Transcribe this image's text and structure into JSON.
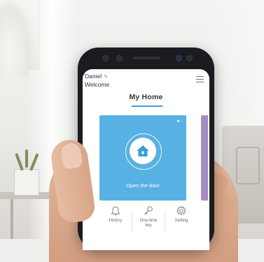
{
  "user": {
    "name": "Daniel",
    "greeting": "Welcome"
  },
  "page": {
    "title": "My Home"
  },
  "card": {
    "action_label": "Open the door",
    "color": "#57b1e2",
    "icon": "home-icon"
  },
  "nav": {
    "items": [
      {
        "label": "History",
        "icon": "bell-icon"
      },
      {
        "label": "One-time\nkey",
        "icon": "key-icon"
      },
      {
        "label": "Setting",
        "icon": "gear-icon"
      }
    ]
  },
  "colors": {
    "accent": "#3aa0d8",
    "side_card": "#a58ec4"
  }
}
